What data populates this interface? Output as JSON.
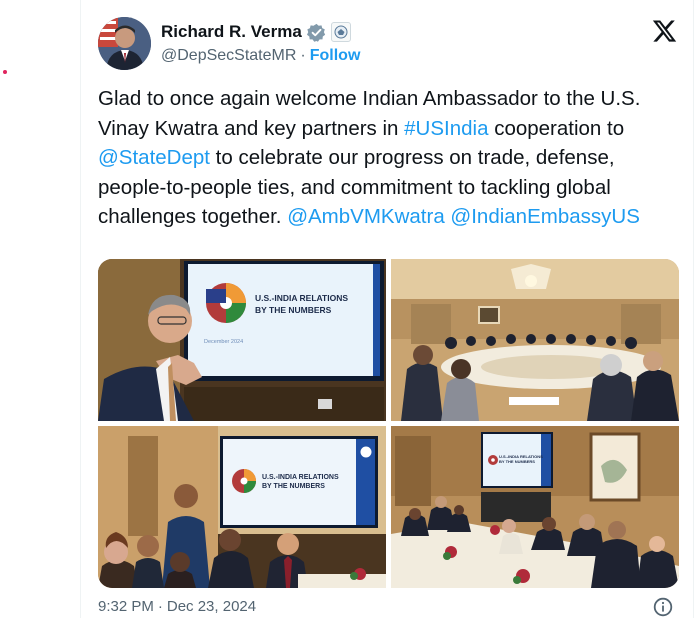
{
  "author": {
    "name": "Richard R. Verma",
    "handle": "@DepSecStateMR",
    "separator": "·",
    "follow_label": "Follow"
  },
  "tweet": {
    "text_1": "Glad to once again welcome Indian Ambassador to the U.S. Vinay Kwatra and key partners in ",
    "hashtag": "#USIndia",
    "text_2": " cooperation to ",
    "mention_1": "@StateDept",
    "text_3": " to celebrate our progress on trade, defense, people-to-people ties, and commitment to tackling global challenges together. ",
    "mention_2": "@AmbVMKwatra",
    "mention_3": "@IndianEmbassyUS"
  },
  "photos": {
    "screen_title_1": "U.S.-INDIA RELATIONS",
    "screen_title_2": "BY THE NUMBERS",
    "screen_date": "December 2024",
    "screen3_title_1": "U.S.-INDIA RELATIONS",
    "screen3_title_2": "BY THE NUMBERS",
    "screen4_title_1": "U.S.-INDIA RELATIONS",
    "screen4_title_2": "BY THE NUMBERS"
  },
  "footer": {
    "time": "9:32 PM",
    "separator": "·",
    "date": "Dec 23, 2024"
  },
  "icons": [
    "verified-badge-icon",
    "government-badge-icon",
    "x-logo-icon",
    "info-icon"
  ],
  "colors": {
    "link": "#1d9bf0",
    "verified": "#829aab",
    "muted": "#536471"
  }
}
